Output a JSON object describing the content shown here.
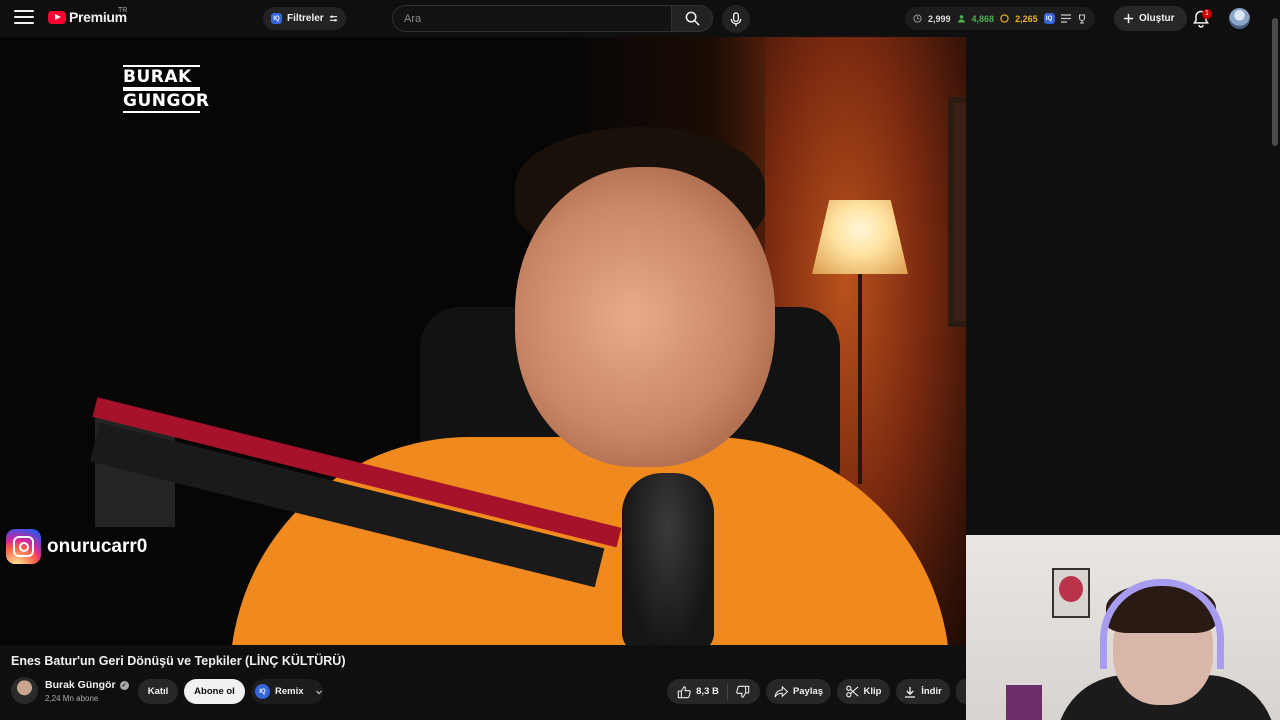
{
  "header": {
    "logo_text": "Premium",
    "country_code": "TR",
    "filter_label": "Filtreler",
    "iq_badge": "IQ",
    "search_placeholder": "Ara",
    "stats": {
      "views": "2,999",
      "users": "4,868",
      "coins": "2,265"
    },
    "create_label": "Oluştur",
    "notification_count": "1"
  },
  "video": {
    "brand_logo_line1": "BURAK",
    "brand_logo_line2": "GUNGOR",
    "instagram_handle": "onurucarr0"
  },
  "info": {
    "title": "Enes Batur'un Geri Dönüşü ve Tepkiler (LİNÇ KÜLTÜRÜ)",
    "channel_name": "Burak Güngör",
    "subscribers": "2,24 Mn abone",
    "join_label": "Katıl",
    "subscribe_label": "Abone ol",
    "remix_label": "Remix",
    "like_count": "8,3 B",
    "share_label": "Paylaş",
    "clip_label": "Klip",
    "download_label": "İndir"
  },
  "colors": {
    "brand_red": "#ff0033",
    "iq_blue": "#3565d8",
    "stat_green": "#4caf50",
    "stat_gold": "#e6b422",
    "shirt_orange": "#f08a1e"
  }
}
